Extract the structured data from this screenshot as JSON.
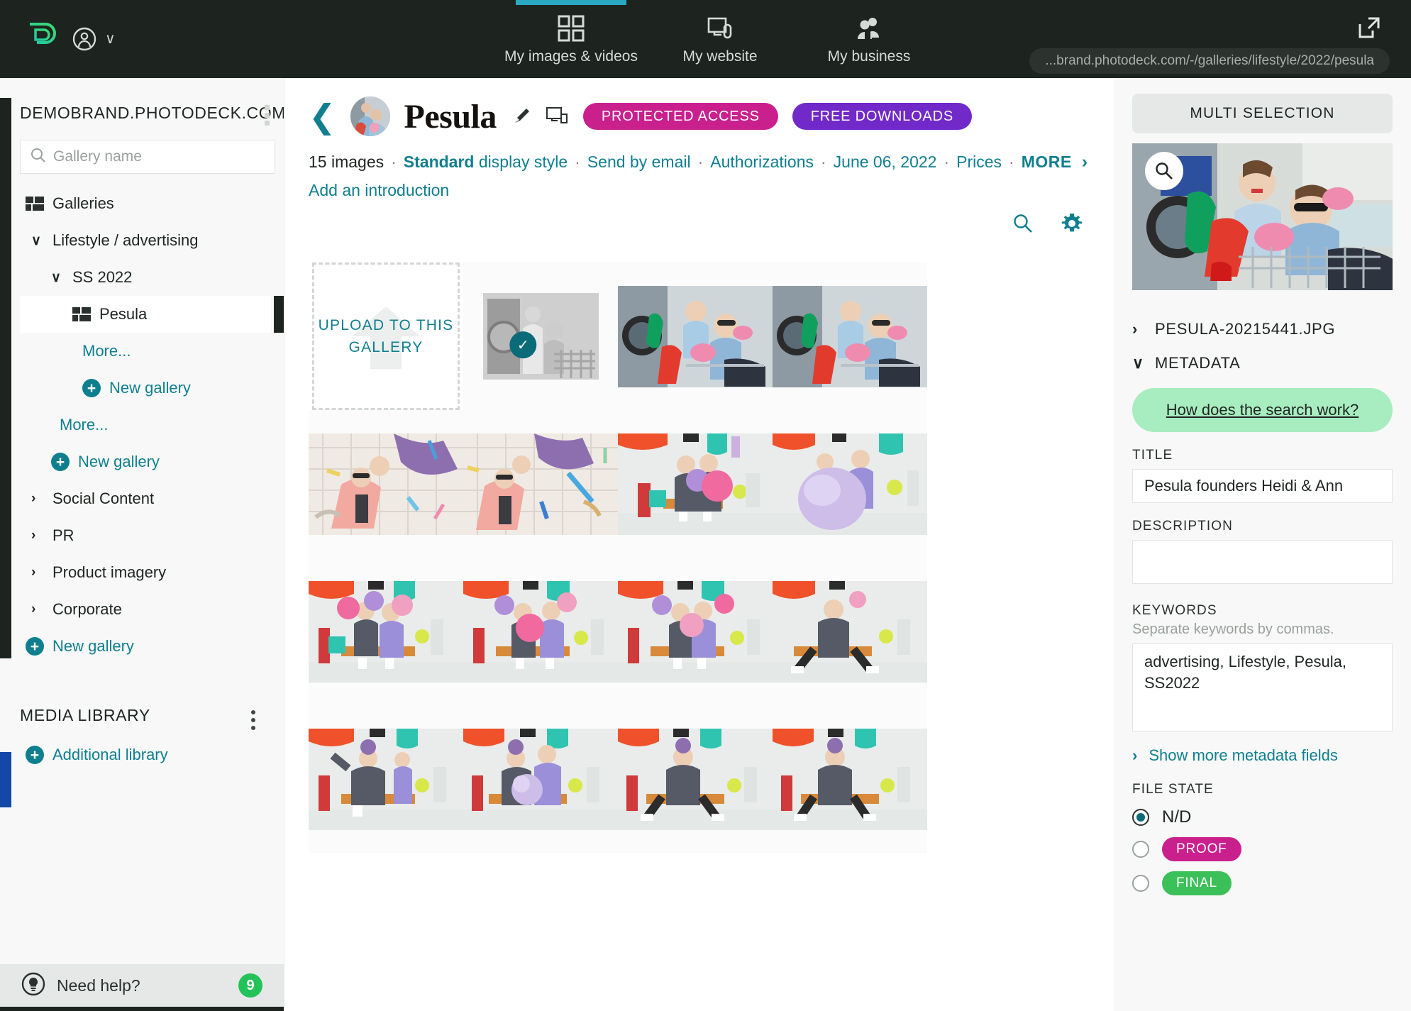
{
  "topbar": {
    "logo_icon": "photodeck-logo-icon",
    "account_icon": "account-circle-icon",
    "account_chevron": "∨",
    "nav": [
      {
        "label": "My images & videos",
        "icon": "grid-icon",
        "active": true
      },
      {
        "label": "My website",
        "icon": "monitor-icon",
        "active": false
      },
      {
        "label": "My business",
        "icon": "people-icon",
        "active": false
      }
    ],
    "external_link_icon": "external-link-icon",
    "url_pill": "...brand.photodeck.com/-/galleries/lifestyle/2022/pesula",
    "active_indicator_color": "#2aa9c4",
    "background_color": "#1d2420"
  },
  "sidebar": {
    "site_title": "DEMOBRAND.PHOTODECK.COM",
    "search": {
      "placeholder": "Gallery name",
      "value": "",
      "icon": "search-icon"
    },
    "tree": [
      {
        "label": "Galleries",
        "level": 0,
        "icon": "galleries-icon",
        "type": "root"
      },
      {
        "label": "Lifestyle / advertising",
        "level": 1,
        "chevron": "∨",
        "type": "folder-open"
      },
      {
        "label": "SS 2022",
        "level": 2,
        "chevron": "∨",
        "type": "folder-open"
      },
      {
        "label": "Pesula",
        "level": 3,
        "icon": "galleries-icon",
        "type": "gallery",
        "selected": true
      },
      {
        "label": "More...",
        "level": 3,
        "type": "link"
      },
      {
        "label": "New gallery",
        "level": 3,
        "type": "action",
        "icon": "plus-circle-icon"
      },
      {
        "label": "More...",
        "level": 2,
        "type": "link"
      },
      {
        "label": "New gallery",
        "level": 2,
        "type": "action",
        "icon": "plus-circle-icon"
      },
      {
        "label": "Social Content",
        "level": 1,
        "chevron": "›",
        "type": "folder"
      },
      {
        "label": "PR",
        "level": 1,
        "chevron": "›",
        "type": "folder"
      },
      {
        "label": "Product imagery",
        "level": 1,
        "chevron": "›",
        "type": "folder"
      },
      {
        "label": "Corporate",
        "level": 1,
        "chevron": "›",
        "type": "folder"
      },
      {
        "label": "New gallery",
        "level": 1,
        "type": "action",
        "icon": "plus-circle-icon"
      }
    ],
    "media_library": {
      "title": "MEDIA LIBRARY",
      "kebab_icon": "kebab-menu-icon"
    },
    "additional_library": {
      "label": "Additional library",
      "icon": "plus-circle-icon"
    },
    "need_help": {
      "label": "Need help?",
      "badge": "9",
      "icon": "lightbulb-icon",
      "badge_color": "#24c359"
    }
  },
  "gallery": {
    "back_icon": "back-chevron-icon",
    "avatar": "gallery-cover-avatar",
    "title": "Pesula",
    "edit_icon": "pencil-icon",
    "preview_icon": "monitor-preview-icon",
    "badges": [
      {
        "label": "PROTECTED ACCESS",
        "color": "#c9208e"
      },
      {
        "label": "FREE DOWNLOADS",
        "color": "#7129c9"
      }
    ],
    "meta": {
      "count": "15 images",
      "display_style_value": "Standard",
      "display_style_suffix": "display style",
      "send_by_email": "Send by email",
      "authorizations": "Authorizations",
      "date": "June 06, 2022",
      "prices": "Prices",
      "more": "MORE",
      "more_chevron": "›",
      "separator": "·"
    },
    "add_intro": "Add an introduction",
    "tools": {
      "search_icon": "search-icon",
      "settings_icon": "gear-icon"
    },
    "upload_tile": {
      "line1": "UPLOAD TO THIS",
      "line2": "GALLERY",
      "icon": "upload-arrow-icon"
    },
    "selected_check_icon": "check-circle-icon"
  },
  "right_panel": {
    "multi_selection": "MULTI SELECTION",
    "zoom_icon": "magnifier-icon",
    "filename": {
      "label": "PESULA-20215441.JPG",
      "chevron": "›"
    },
    "metadata_section": {
      "label": "METADATA",
      "chevron": "∨"
    },
    "search_help": "How does the search work?",
    "fields": {
      "title_label": "TITLE",
      "title_value": "Pesula founders Heidi & Ann",
      "description_label": "DESCRIPTION",
      "description_value": "",
      "keywords_label": "KEYWORDS",
      "keywords_hint": "Separate keywords by commas.",
      "keywords_value": "advertising, Lifestyle, Pesula, SS2022"
    },
    "show_more": {
      "label": "Show more metadata fields",
      "chevron": "›"
    },
    "file_state": {
      "label": "FILE STATE",
      "options": [
        {
          "label": "N/D",
          "selected": true,
          "style": "plain"
        },
        {
          "label": "PROOF",
          "selected": false,
          "style": "pill",
          "color": "#c9208e"
        },
        {
          "label": "FINAL",
          "selected": false,
          "style": "pill",
          "color": "#3cc05a"
        }
      ]
    }
  }
}
